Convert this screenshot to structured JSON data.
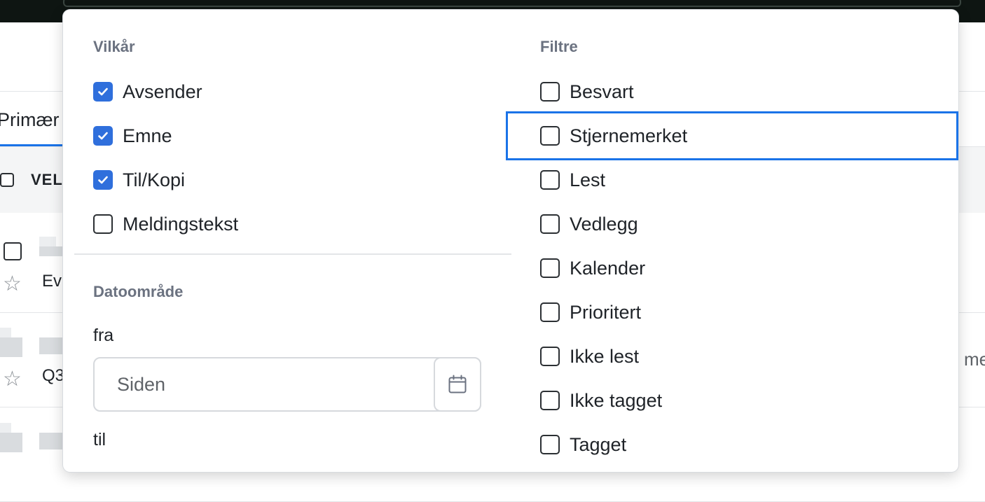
{
  "background": {
    "tab_primary": "Primær",
    "select_label": "VEL",
    "rows": [
      {
        "subject": "Ev"
      },
      {
        "subject": "Q3"
      }
    ],
    "right_text": "me"
  },
  "panel": {
    "conditions": {
      "title": "Vilkår",
      "items": [
        {
          "label": "Avsender",
          "checked": true
        },
        {
          "label": "Emne",
          "checked": true
        },
        {
          "label": "Til/Kopi",
          "checked": true
        },
        {
          "label": "Meldingstekst",
          "checked": false
        }
      ]
    },
    "date_range": {
      "title": "Datoområde",
      "from_label": "fra",
      "from_placeholder": "Siden",
      "to_label": "til"
    },
    "filters": {
      "title": "Filtre",
      "focused": "Stjernemerket",
      "items": [
        {
          "label": "Besvart",
          "checked": false
        },
        {
          "label": "Stjernemerket",
          "checked": false
        },
        {
          "label": "Lest",
          "checked": false
        },
        {
          "label": "Vedlegg",
          "checked": false
        },
        {
          "label": "Kalender",
          "checked": false
        },
        {
          "label": "Prioritert",
          "checked": false
        },
        {
          "label": "Ikke lest",
          "checked": false
        },
        {
          "label": "Ikke tagget",
          "checked": false
        },
        {
          "label": "Tagget",
          "checked": false
        }
      ]
    }
  },
  "colors": {
    "accent": "#2f6fdc",
    "focus": "#1a73e8",
    "topbar": "#0e1512"
  },
  "icons": {
    "checkbox_checked": "check-icon",
    "date_picker": "calendar-icon",
    "star": "star-outline-icon"
  }
}
